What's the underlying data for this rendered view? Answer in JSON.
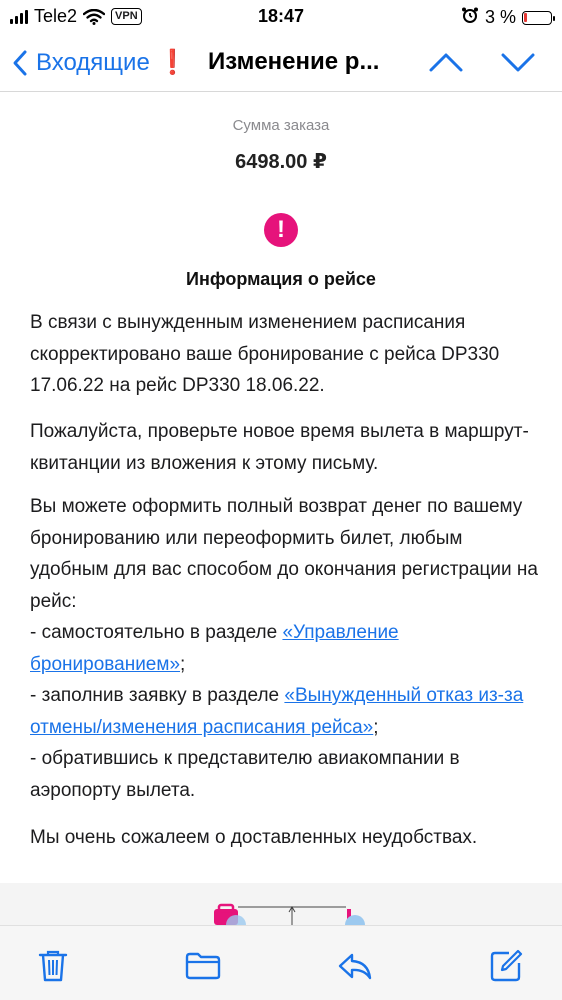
{
  "status_bar": {
    "carrier": "Tele2",
    "vpn": "VPN",
    "time": "18:47",
    "battery_percent": "3 %",
    "battery_level": 0.03
  },
  "nav": {
    "back_label": "Входящие",
    "flag": "❗",
    "title": "Изменение р...",
    "icons": [
      "chevron-left-icon",
      "chevron-up-icon",
      "chevron-down-icon"
    ]
  },
  "order": {
    "label": "Сумма заказа",
    "value": "6498.00 ₽"
  },
  "flight_info": {
    "icon": "!",
    "title": "Информация о рейсе",
    "paragraph1": "В связи с вынужденным изменением расписания скорректировано ваше бронирование с рейса DP330 17.06.22 на рейс DP330 18.06.22.",
    "paragraph2": "Пожалуйста, проверьте новое время вылета в маршрут-квитанции из вложения к этому письму.",
    "paragraph3_intro": "Вы можете оформить полный возврат денег по вашему бронированию или переоформить билет, любым удобным для вас способом до окончания регистрации на рейс:",
    "option1_prefix": "- самостоятельно в разделе ",
    "option1_link": "«Управление бронированием»",
    "option1_suffix": ";",
    "option2_prefix": "- заполнив заявку в разделе ",
    "option2_link": "«Вынужденный отказ из-за отмены/изменения расписания рейса»",
    "option2_suffix": ";",
    "option3": "- обратившись к представителю авиакомпании в аэропорту вылета.",
    "paragraph4": "Мы очень сожалеем о доставленных неудобствах."
  },
  "toolbar": {
    "icons": [
      "trash-icon",
      "folder-icon",
      "reply-icon",
      "compose-icon"
    ]
  },
  "colors": {
    "accent": "#1a73e8",
    "warning": "#e6137b",
    "flag": "#e0222a"
  }
}
